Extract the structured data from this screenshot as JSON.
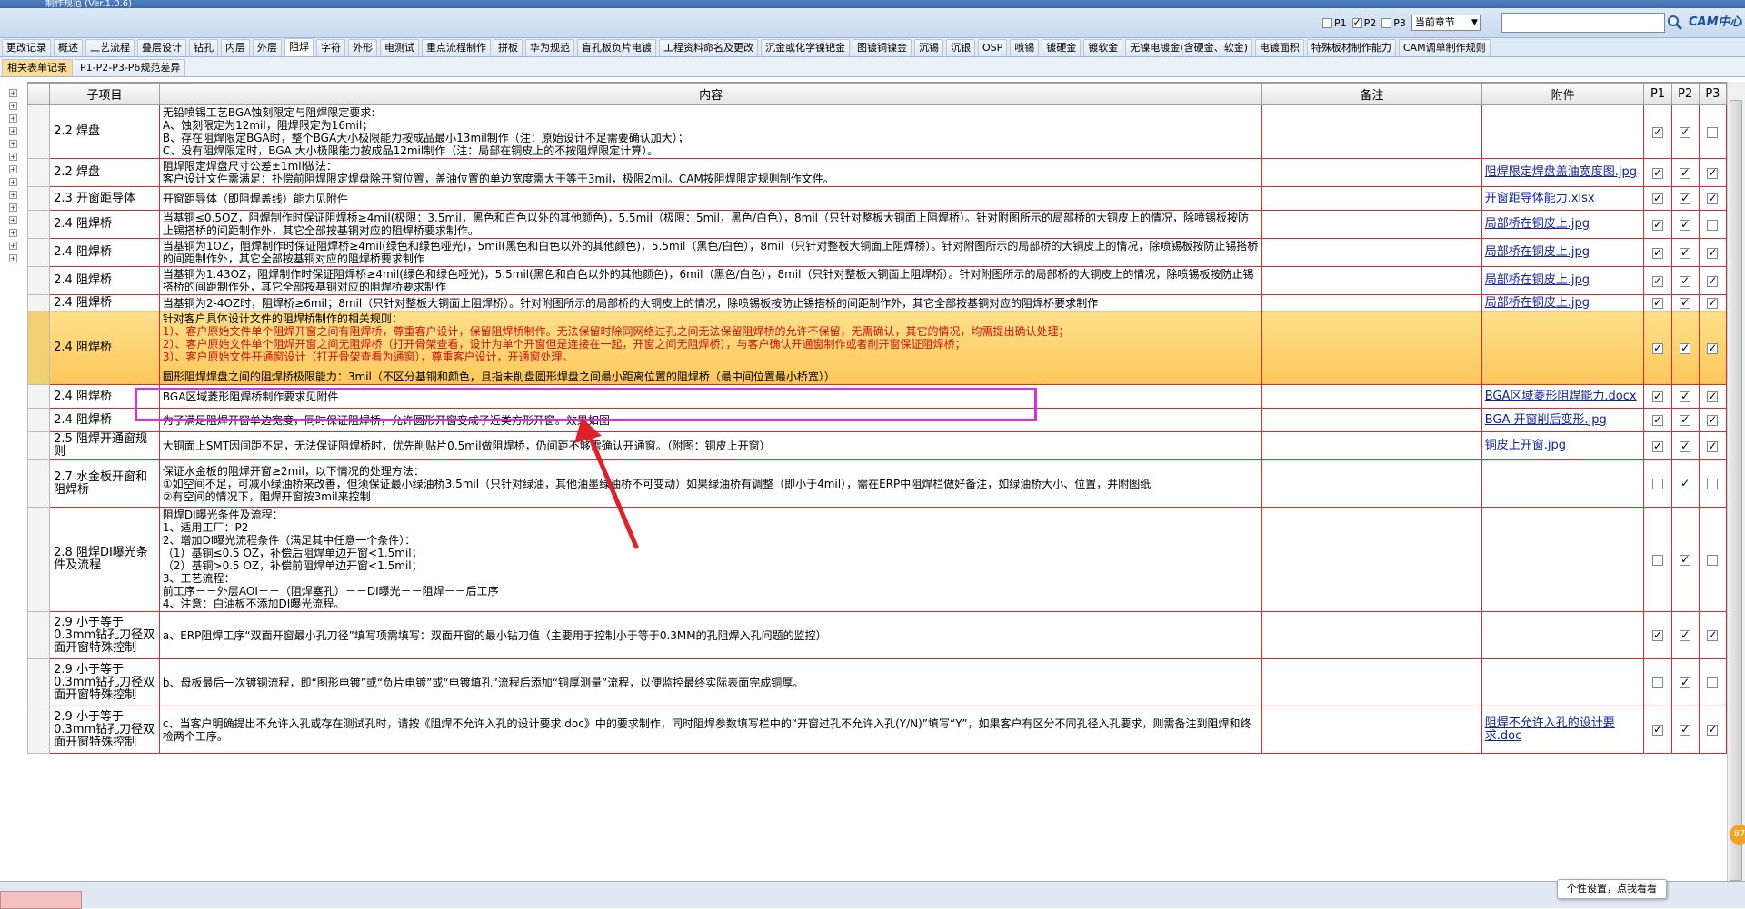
{
  "window": {
    "title": "制作规范 (Ver.1.0.6)"
  },
  "filters": {
    "p1": "P1",
    "p2": "P2",
    "p3": "P3",
    "p1_checked": false,
    "p2_checked": true,
    "p3_checked": false,
    "section": "当前章节"
  },
  "search": {
    "placeholder": ""
  },
  "logo": "CAM中心",
  "tabs": [
    "更改记录",
    "概述",
    "工艺流程",
    "叠层设计",
    "钻孔",
    "内层",
    "外层",
    "阻焊",
    "字符",
    "外形",
    "电测试",
    "重点流程制作",
    "拼板",
    "华为规范",
    "盲孔板负片电镀",
    "工程资料命名及更改",
    "沉金或化学镍钯金",
    "图镀铜镍金",
    "沉锡",
    "沉银",
    "OSP",
    "喷锡",
    "镀硬金",
    "镀软金",
    "无镍电镀金(含硬金、软金)",
    "电镀面积",
    "特殊板材制作能力",
    "CAM调单制作规则"
  ],
  "active_tab": "阻焊",
  "subtabs": [
    "相关表单记录",
    "P1-P2-P3-P6规范差异"
  ],
  "active_subtab": "相关表单记录",
  "columns": {
    "sub": "子项目",
    "content": "内容",
    "note": "备注",
    "attach": "附件",
    "p1": "P1",
    "p2": "P2",
    "p3": "P3"
  },
  "rows": [
    {
      "sub": "2.2 焊盘",
      "content": [
        "无铅喷锡工艺BGA蚀刻限定与阻焊限定要求:",
        "A、蚀刻限定为12mil，阻焊限定为16mil；",
        "B、存在阻焊限定BGA时，整个BGA大小极限能力按成品最小13mil制作（注：原始设计不足需要确认加大）；",
        "C、没有阻焊限定时，BGA 大小极限能力按成品12mil制作（注：局部在铜皮上的不按阻焊限定计算）。"
      ],
      "attach": "",
      "p1": true,
      "p2": true,
      "p3": false
    },
    {
      "sub": "2.2 焊盘",
      "content": [
        "阻焊限定焊盘尺寸公差±1mil做法：",
        "客户设计文件需满足：扑偿前阻焊限定焊盘除开窗位置，盖油位置的单边宽度需大于等于3mil，极限2mil。CAM按阻焊限定规则制作文件。"
      ],
      "attach": "阻焊限定焊盘盖油宽度图.jpg",
      "p1": true,
      "p2": true,
      "p3": true
    },
    {
      "sub": "2.3 开窗距导体",
      "content": [
        "开窗距导体（即阻焊盖线）能力见附件"
      ],
      "attach": "开窗距导体能力.xlsx",
      "p1": true,
      "p2": true,
      "p3": true
    },
    {
      "sub": "2.4 阻焊桥",
      "content": [
        "当基铜≤0.5OZ，阻焊制作时保证阻焊桥≥4mil(极限：3.5mil，黑色和白色以外的其他颜色)，5.5mil（极限：5mil，黑色/白色），8mil（只针对整板大铜面上阻焊桥）。针对附图所示的局部桥的大铜皮上的情况，除喷锡板按防止锡搭桥的间距制作外，其它全部按基铜对应的阻焊桥要求制作。"
      ],
      "attach": "局部桥在铜皮上.jpg",
      "p1": true,
      "p2": true,
      "p3": false
    },
    {
      "sub": "2.4 阻焊桥",
      "content": [
        "当基铜为1OZ，阻焊制作时保证阻焊桥≥4mil(绿色和绿色哑光)，5mil(黑色和白色以外的其他颜色)，5.5mil（黑色/白色），8mil（只针对整板大铜面上阻焊桥）。针对附图所示的局部桥的大铜皮上的情况，除喷锡板按防止锡搭桥的间距制作外，其它全部按基铜对应的阻焊桥要求制作"
      ],
      "attach": "局部桥在铜皮上.jpg",
      "p1": true,
      "p2": true,
      "p3": true
    },
    {
      "sub": "2.4 阻焊桥",
      "content": [
        "当基铜为1.43OZ，阻焊制作时保证阻焊桥≥4mil(绿色和绿色哑光)，5.5mil(黑色和白色以外的其他颜色)，6mil（黑色/白色），8mil（只针对整板大铜面上阻焊桥）。针对附图所示的局部桥的大铜皮上的情况，除喷锡板按防止锡搭桥的间距制作外，其它全部按基铜对应的阻焊桥要求制作"
      ],
      "attach": "局部桥在铜皮上.jpg",
      "p1": true,
      "p2": true,
      "p3": true
    },
    {
      "sub": "2.4 阻焊桥",
      "content": [
        "当基铜为2-4OZ时，阻焊桥≥6mil；8mil（只针对整板大铜面上阻焊桥）。针对附图所示的局部桥的大铜皮上的情况，除喷锡板按防止锡搭桥的间距制作外，其它全部按基铜对应的阻焊桥要求制作"
      ],
      "attach": "局部桥在铜皮上.jpg",
      "p1": true,
      "p2": true,
      "p3": true
    },
    {
      "sub": "2.4 阻焊桥",
      "content": [
        "针对客户具体设计文件的阻焊桥制作的相关规则：",
        "1）、客户原始文件单个阻焊开窗之间有阻焊桥，尊重客户设计，保留阻焊桥制作。无法保留时除同网络过孔之间无法保留阻焊桥的允许不保留，无需确认，其它的情况，均需提出确认处理；",
        "2）、客户原始文件单个阻焊开窗之间无阻焊桥（打开骨架查看，设计为单个开窗但是连接在一起，开窗之间无阻焊桥），与客户确认开通窗制作或者削开窗保证阻焊桥；",
        "3）、客户原始文件开通窗设计（打开骨架查看为通窗），尊重客户设计，开通窗处理。",
        "",
        "圆形阻焊焊盘之间的阻焊桥极限能力：3mil（不区分基铜和颜色，且指未削盘圆形焊盘之间最小距离位置的阻焊桥（最中间位置最小桥宽））"
      ],
      "attach": "",
      "p1": true,
      "p2": true,
      "p3": true,
      "highlight": true
    },
    {
      "sub": "2.4 阻焊桥",
      "content": [
        "BGA区域菱形阻焊桥制作要求见附件"
      ],
      "attach": "BGA区域菱形阻焊能力.docx",
      "p1": true,
      "p2": true,
      "p3": true
    },
    {
      "sub": "2.4 阻焊桥",
      "content": [
        "为了满足阻焊开窗单边宽度，同时保证阻焊桥，允许圆形开窗变成了近类方形开窗。效果如图"
      ],
      "attach": "BGA 开窗削后变形.jpg",
      "p1": true,
      "p2": true,
      "p3": true
    },
    {
      "sub": "2.5 阻焊开通窗规则",
      "content": [
        "大铜面上SMT因间距不足，无法保证阻焊桥时，优先削贴片0.5mil做阻焊桥，仍间距不够需确认开通窗。（附图：铜皮上开窗）"
      ],
      "attach": "铜皮上开窗.jpg",
      "p1": true,
      "p2": true,
      "p3": true
    },
    {
      "sub": "2.7 水金板开窗和阻焊桥",
      "content": [
        "保证水金板的阻焊开窗≥2mil，以下情况的处理方法：",
        "①如空间不足，可减小绿油桥来改善，但须保证最小绿油桥3.5mil（只针对绿油，其他油墨绿油桥不可变动）如果绿油桥有调整（即小于4mil），需在ERP中阻焊栏做好备注，如绿油桥大小、位置，并附图纸",
        "②有空间的情况下，阻焊开窗按3mil来控制"
      ],
      "attach": "",
      "p1": false,
      "p2": true,
      "p3": false
    },
    {
      "sub": "2.8 阻焊DI曝光条件及流程",
      "content": [
        "阻焊DI曝光条件及流程：",
        "1、适用工厂：P2",
        "2、增加DI曝光流程条件（满足其中任意一个条件）：",
        "（1）基铜≤0.5 OZ，补偿后阻焊单边开窗<1.5mil；",
        "（2）基铜>0.5 OZ，补偿前阻焊单边开窗<1.5mil；",
        "3、工艺流程：",
        "前工序－－外层AOI－－（阻焊塞孔）－－DI曝光－－阻焊－－后工序",
        "4、注意：白油板不添加DI曝光流程。"
      ],
      "attach": "",
      "p1": false,
      "p2": true,
      "p3": false
    },
    {
      "sub": "2.9 小于等于0.3mm钻孔刀径双面开窗特殊控制",
      "content": [
        "a、ERP阻焊工序“双面开窗最小孔刀径”填写项需填写：双面开窗的最小钻刀值（主要用于控制小于等于0.3MM的孔阻焊入孔问题的监控）"
      ],
      "attach": "",
      "p1": true,
      "p2": true,
      "p3": true
    },
    {
      "sub": "2.9 小于等于0.3mm钻孔刀径双面开窗特殊控制",
      "content": [
        "b、母板最后一次镀铜流程，即“图形电镀”或“负片电镀”或“电镀填孔”流程后添加“铜厚测量”流程，以便监控最终实际表面完成铜厚。"
      ],
      "attach": "",
      "p1": false,
      "p2": true,
      "p3": false
    },
    {
      "sub": "2.9 小于等于0.3mm钻孔刀径双面开窗特殊控制",
      "content": [
        "c、当客户明确提出不允许入孔或存在测试孔时，请按《阻焊不允许入孔的设计要求.doc》中的要求制作，同时阻焊参数填写栏中的“开窗过孔不允许入孔(Y/N)”填写“Y”，如果客户有区分不同孔径入孔要求，则需备注到阻焊和终检两个工序。"
      ],
      "attach": "阻焊不允许入孔的设计要求.doc",
      "p1": true,
      "p2": true,
      "p3": true
    }
  ],
  "status": {
    "tooltip": "个性设置，点我看看",
    "bubble": "87"
  }
}
